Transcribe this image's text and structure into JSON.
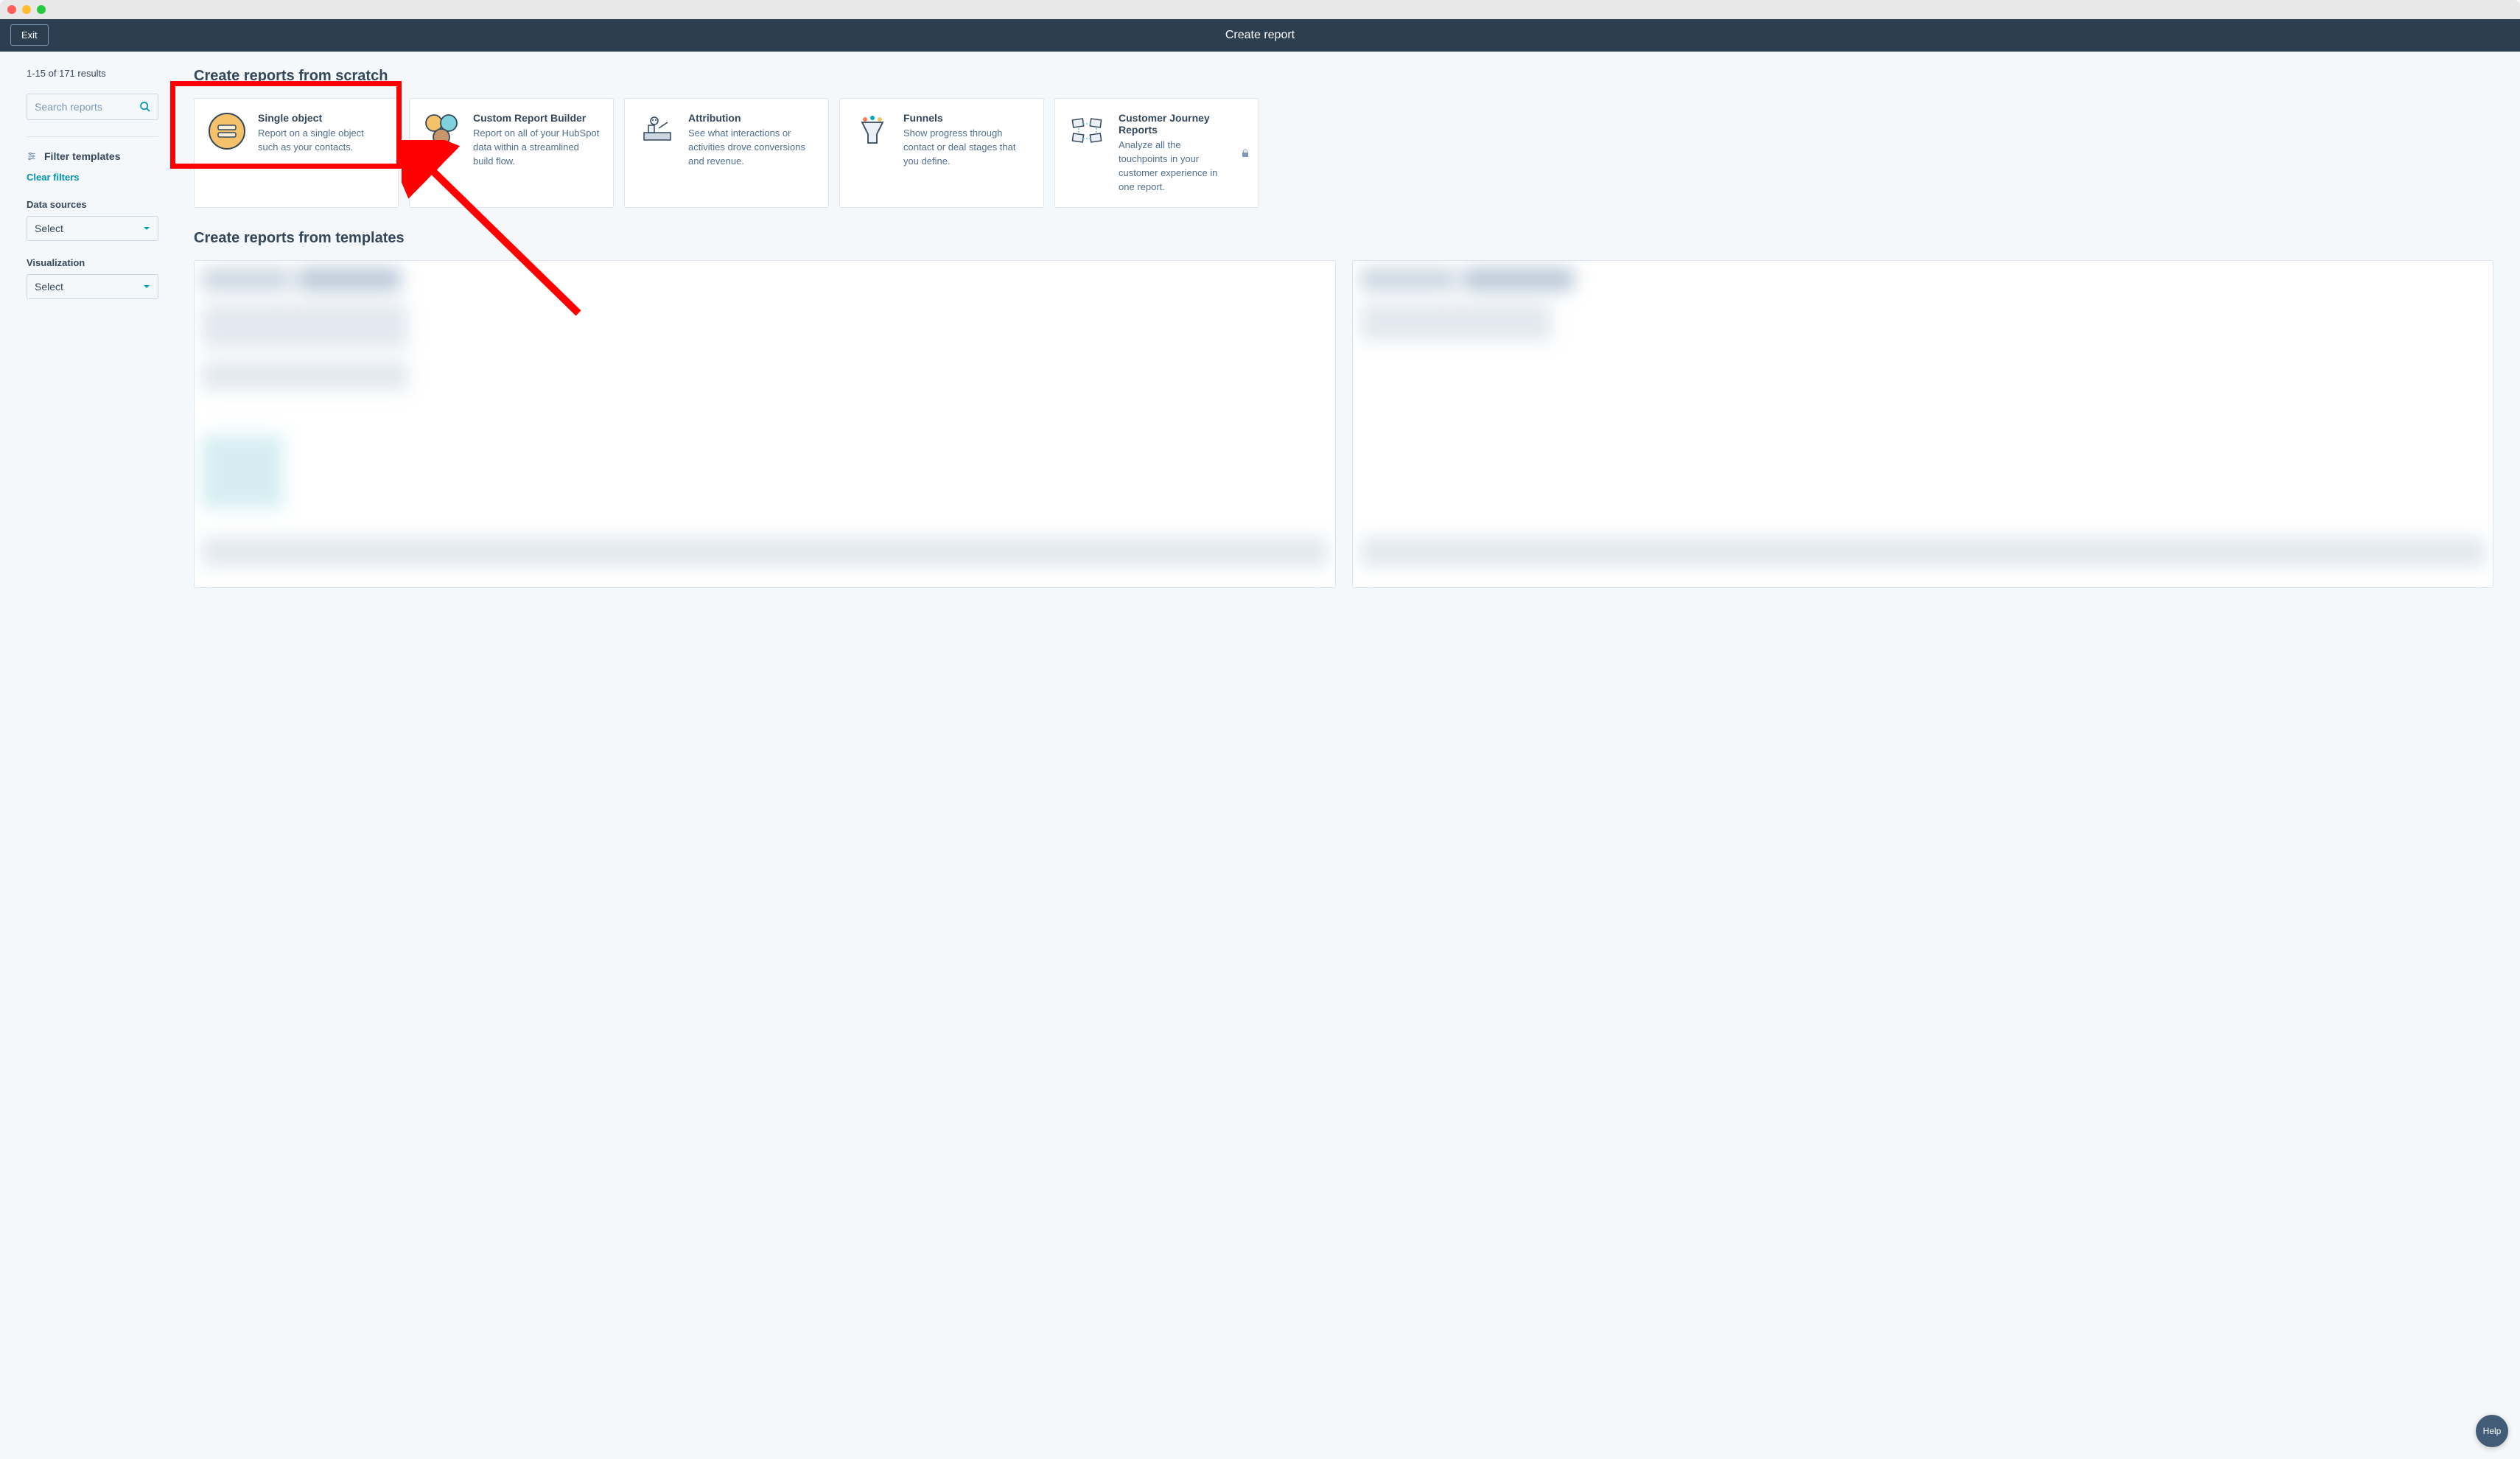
{
  "topbar": {
    "exit": "Exit",
    "title": "Create report"
  },
  "sidebar": {
    "result_count": "1-15 of 171 results",
    "search_placeholder": "Search reports",
    "filter_heading": "Filter templates",
    "clear_filters": "Clear filters",
    "data_sources_label": "Data sources",
    "data_sources_value": "Select",
    "visualization_label": "Visualization",
    "visualization_value": "Select"
  },
  "sections": {
    "from_scratch": "Create reports from scratch",
    "from_templates": "Create reports from templates"
  },
  "cards": {
    "single_object": {
      "title": "Single object",
      "desc": "Report on a single object such as your contacts."
    },
    "custom_builder": {
      "title": "Custom Report Builder",
      "desc": "Report on all of your HubSpot data within a streamlined build flow."
    },
    "attribution": {
      "title": "Attribution",
      "desc": "See what interactions or activities drove conversions and revenue."
    },
    "funnels": {
      "title": "Funnels",
      "desc": "Show progress through contact or deal stages that you define."
    },
    "journey": {
      "title": "Customer Journey Reports",
      "desc": "Analyze all the touchpoints in your customer experience in one report."
    }
  },
  "help": {
    "label": "Help"
  }
}
